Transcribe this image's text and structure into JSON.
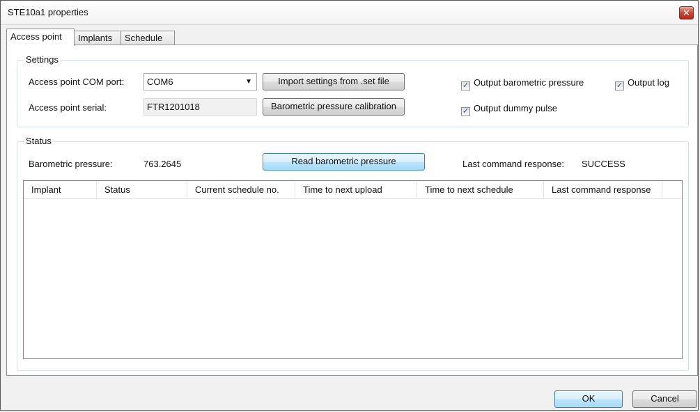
{
  "window": {
    "title": "STE10a1 properties",
    "close_glyph": "✕"
  },
  "tabs": [
    {
      "label": "Access point",
      "active": true
    },
    {
      "label": "Implants",
      "active": false
    },
    {
      "label": "Schedule",
      "active": false
    }
  ],
  "settings": {
    "group_label": "Settings",
    "com_port_label": "Access point COM port:",
    "com_port_value": "COM6",
    "serial_label": "Access point serial:",
    "serial_value": "FTR1201018",
    "import_button": "Import settings from .set file",
    "calibration_button": "Barometric pressure calibration",
    "output_barometric": {
      "label": "Output barometric pressure",
      "checked": true
    },
    "output_log": {
      "label": "Output log",
      "checked": true
    },
    "output_dummy": {
      "label": "Output dummy pulse",
      "checked": true
    }
  },
  "status": {
    "group_label": "Status",
    "pressure_label": "Barometric pressure:",
    "pressure_value": "763.2645",
    "read_button": "Read barometric pressure",
    "last_response_label": "Last command response:",
    "last_response_value": "SUCCESS",
    "columns": [
      "Implant",
      "Status",
      "Current schedule no.",
      "Time to next upload",
      "Time to next schedule",
      "Last command response"
    ],
    "rows": []
  },
  "footer": {
    "ok_label": "OK",
    "cancel_label": "Cancel"
  },
  "icons": {
    "dropdown": "chevron-down-icon",
    "checkmark": "checkmark-icon",
    "close": "close-icon"
  }
}
